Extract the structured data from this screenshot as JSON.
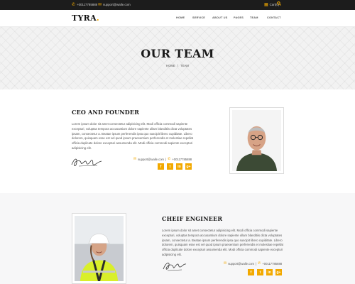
{
  "topbar": {
    "phone": "+00117785888",
    "email": "support@walle.com",
    "cart": "Cart(0)"
  },
  "header": {
    "logo": "TYRA",
    "logo_dot": ".",
    "nav": [
      "HOME",
      "SERVICE",
      "ABOUT US",
      "PAGES",
      "TEAM",
      "CONTACT"
    ]
  },
  "hero": {
    "title": "OUR TEAM",
    "breadcrumb": [
      "HOME",
      "/",
      "TEAM"
    ]
  },
  "members": [
    {
      "role": "CEO AND FOUNDER",
      "bio": "Lorem ipsum dolor sit amet consectetur adipisicing elit. Modi officia commodi sapiente excepturi, voluptas tempora accusantium dolore sapiente ullam blanditiis dicta voluptates ipsam, consectetur a. Beatae ipsum perferendis ipsa quo suscipit libero cupiditate. Libero dolorem, quisquam esse est vel quod ipsum praesentium perferendis et molestiae repellat officia duplicate dolore excepturi assumenda elit. Modi officia commodi sapiente excepturi adipisicing elit.",
      "email": "support@walle.com",
      "phone": "+00117785888"
    },
    {
      "role": "CHEIF ENGINEER",
      "bio": "Lorem ipsum dolor sit amet consectetur adipisicing elit. Modi officia commodi sapiente excepturi, voluptas tempora accusantium dolore sapiente ullam blanditiis dicta voluptates ipsam, consectetur a. Beatae ipsum perferendis ipsa quo suscipit libero cupiditate. Libero dolorem, quisquam esse est vel quod ipsum praesentium perferendis et molestiae repellat officia duplicate dolore excepturi assumenda elit. Modi officia commodi sapiente excepturi adipisicing elit.",
      "email": "support@walle.com",
      "phone": "+00117785888"
    }
  ],
  "social_icons": [
    "facebook-icon",
    "twitter-icon",
    "linkedin-icon",
    "google-plus-icon"
  ],
  "social_glyphs": [
    "f",
    "t",
    "in",
    "g+"
  ],
  "colors": {
    "accent": "#f2a900",
    "topbar": "#1c1c1c",
    "heading": "#1a1a1a",
    "section_alt_bg": "#f7f7f8"
  }
}
